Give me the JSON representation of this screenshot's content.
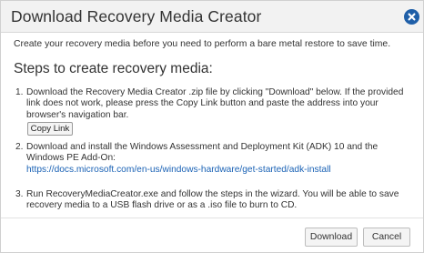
{
  "dialog": {
    "title": "Download Recovery Media Creator",
    "close_icon": "close-circle-icon"
  },
  "intro": "Create your recovery media before you need to perform a bare metal restore to save time.",
  "heading": "Steps to create recovery media:",
  "steps": [
    {
      "number": "1.",
      "lines": [
        "Download the Recovery Media Creator .zip file by clicking \"Download\" below. If the provided",
        "link does not work, please press the Copy Link button and paste the address into your",
        "browser's navigation bar."
      ],
      "button_label": "Copy Link"
    },
    {
      "number": "2.",
      "lines": [
        "Download and install the Windows Assessment and Deployment Kit (ADK) 10 and the",
        "Windows PE Add-On:"
      ],
      "link": "https://docs.microsoft.com/en-us/windows-hardware/get-started/adk-install"
    },
    {
      "number": "3.",
      "lines": [
        "Run RecoveryMediaCreator.exe and follow the steps in the wizard. You will be able to save",
        "recovery media to a USB flash drive or as a .iso file to burn to CD."
      ]
    }
  ],
  "footer": {
    "download_label": "Download",
    "cancel_label": "Cancel"
  },
  "colors": {
    "close_button": "#1f5fa8",
    "link": "#1a62b5",
    "titlebar": "#f2f2f2"
  }
}
